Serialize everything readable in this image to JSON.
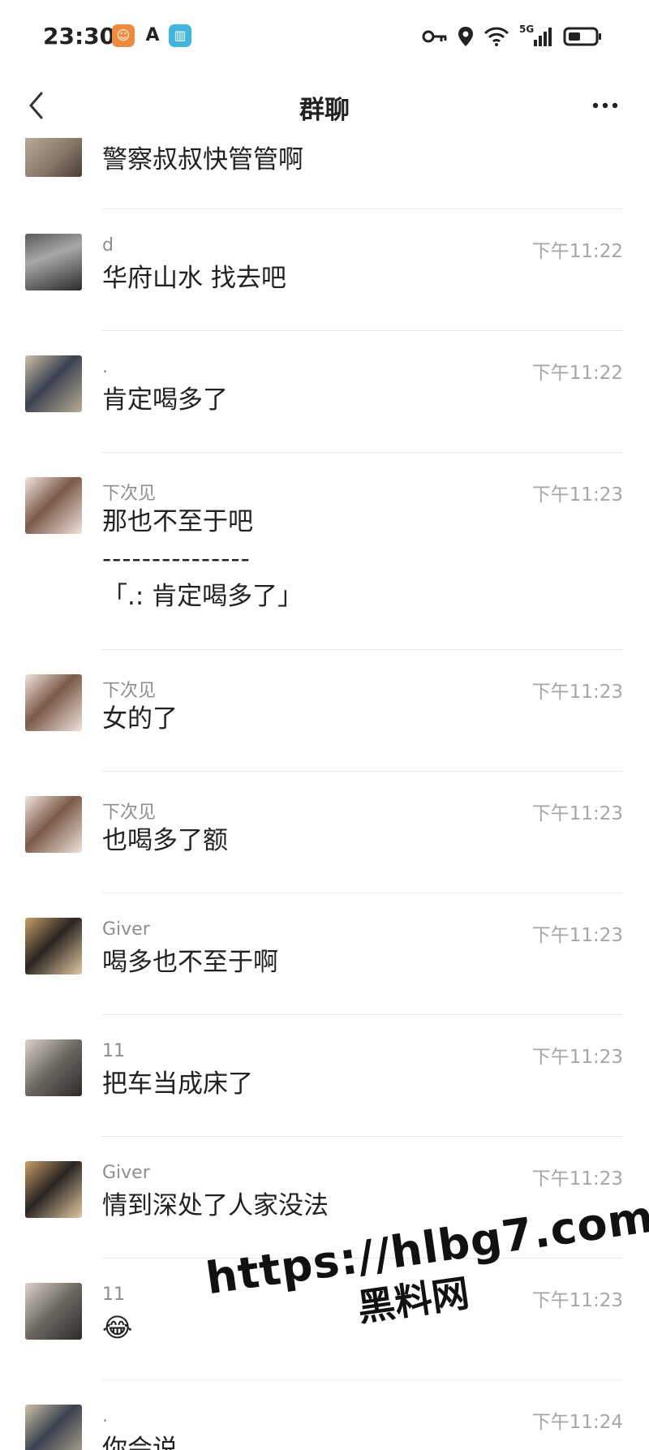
{
  "status_bar": {
    "time": "23:30",
    "network": "5G",
    "app_icons": [
      "taobao-icon",
      "a-icon",
      "book-icon"
    ],
    "icons": [
      "key-icon",
      "location-icon",
      "wifi-icon",
      "signal-icon",
      "battery-icon"
    ]
  },
  "nav": {
    "title": "群聊",
    "back_icon": "chevron-left-icon",
    "more_icon": "more-dots-icon"
  },
  "messages": [
    {
      "sender": "",
      "time": "",
      "lines": [
        "警察叔叔快管管啊"
      ],
      "avatar": "avatar-1"
    },
    {
      "sender": "d",
      "time": "下午11:22",
      "lines": [
        "华府山水 找去吧"
      ],
      "avatar": "avatar-d"
    },
    {
      "sender": ".",
      "time": "下午11:22",
      "lines": [
        "肯定喝多了"
      ],
      "avatar": "avatar-dot"
    },
    {
      "sender": "下次见",
      "time": "下午11:23",
      "lines": [
        "那也不至于吧",
        "---------------",
        "「.: 肯定喝多了」"
      ],
      "avatar": "avatar-xiacijian"
    },
    {
      "sender": "下次见",
      "time": "下午11:23",
      "lines": [
        "女的了"
      ],
      "avatar": "avatar-xiacijian"
    },
    {
      "sender": "下次见",
      "time": "下午11:23",
      "lines": [
        "也喝多了额"
      ],
      "avatar": "avatar-xiacijian"
    },
    {
      "sender": "Giver",
      "time": "下午11:23",
      "lines": [
        "喝多也不至于啊"
      ],
      "avatar": "avatar-giver"
    },
    {
      "sender": "11",
      "time": "下午11:23",
      "lines": [
        "把车当成床了"
      ],
      "avatar": "avatar-11"
    },
    {
      "sender": "Giver",
      "time": "下午11:23",
      "lines": [
        "情到深处了人家没法"
      ],
      "avatar": "avatar-giver"
    },
    {
      "sender": "11",
      "time": "下午11:23",
      "lines": [
        "😂"
      ],
      "avatar": "avatar-11"
    },
    {
      "sender": ".",
      "time": "下午11:24",
      "lines": [
        "你会说"
      ],
      "avatar": "avatar-dot"
    }
  ],
  "watermark": {
    "url": "https://hlbg7.com",
    "name": "黑料网"
  },
  "colors": {
    "text": "#222222",
    "meta": "#a6a6a6",
    "divider": "#e6e6e6",
    "background": "#ffffff"
  }
}
